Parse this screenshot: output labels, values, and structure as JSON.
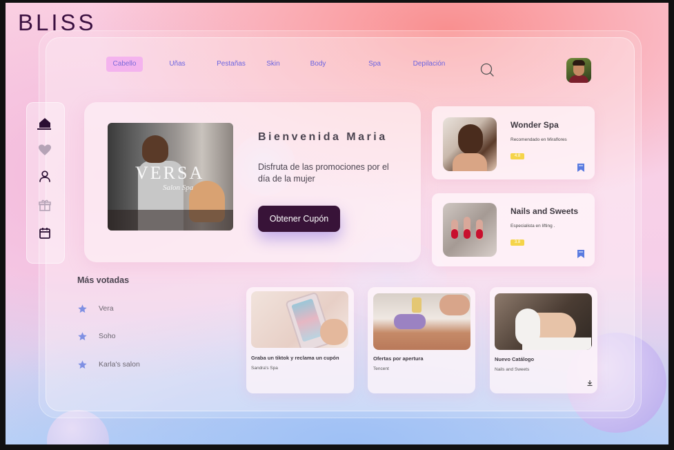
{
  "app": {
    "brand": "BLISS"
  },
  "nav": {
    "tabs": [
      {
        "label": "Cabello",
        "active": true
      },
      {
        "label": "Uñas"
      },
      {
        "label": "Pestañas"
      },
      {
        "label": "Skin"
      },
      {
        "label": "Body"
      },
      {
        "label": "Spa"
      },
      {
        "label": "Depilación"
      }
    ],
    "search_icon": "search-icon"
  },
  "sidebar": {
    "items": [
      {
        "icon": "home-icon",
        "active": true
      },
      {
        "icon": "heart-icon"
      },
      {
        "icon": "user-icon"
      },
      {
        "icon": "gift-icon"
      },
      {
        "icon": "calendar-icon"
      }
    ]
  },
  "hero": {
    "image_logo": "VERSA",
    "image_logo_sub": "Salon Spa",
    "title": "Bienvenida Maria",
    "description": "Disfruta de las promociones por el día de la mujer",
    "button_label": "Obtener Cupón"
  },
  "spas": [
    {
      "name": "Wonder Spa",
      "subtitle": "Recomendado en Miraflores",
      "rating": "4.8"
    },
    {
      "name": "Nails and Sweets",
      "subtitle": "Especialista en lifting .",
      "rating": "3.8"
    }
  ],
  "top_voted": {
    "title": "Más votadas",
    "items": [
      "Vera",
      "Soho",
      "Karla's salon"
    ]
  },
  "promos": [
    {
      "title": "Graba un tiktok y reclama un cupón",
      "subtitle": "Sandra's Spa"
    },
    {
      "title": "Ofertas por apertura",
      "subtitle": "Tencent"
    },
    {
      "title": "Nuevo Catálogo",
      "subtitle": "Nails and Sweets"
    }
  ],
  "colors": {
    "accent_dark": "#381338",
    "nav_text": "#6a63e0",
    "active_tab": "#f4b3ee",
    "star": "#7f90e3",
    "rating_badge": "#f5d44a",
    "bookmark": "#5a7be0"
  }
}
